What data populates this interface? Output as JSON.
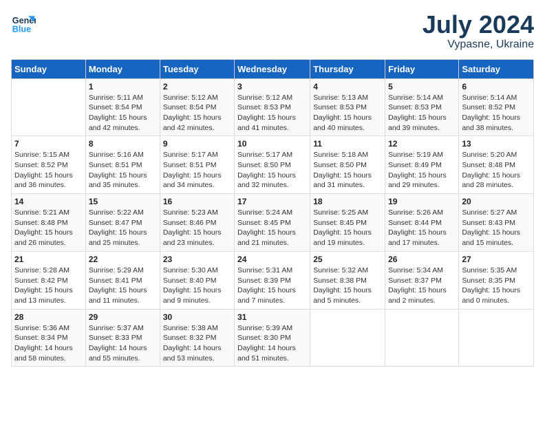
{
  "header": {
    "logo_line1": "General",
    "logo_line2": "Blue",
    "month_year": "July 2024",
    "location": "Vypasne, Ukraine"
  },
  "weekdays": [
    "Sunday",
    "Monday",
    "Tuesday",
    "Wednesday",
    "Thursday",
    "Friday",
    "Saturday"
  ],
  "weeks": [
    [
      {
        "day": "",
        "info": ""
      },
      {
        "day": "1",
        "info": "Sunrise: 5:11 AM\nSunset: 8:54 PM\nDaylight: 15 hours and 42 minutes."
      },
      {
        "day": "2",
        "info": "Sunrise: 5:12 AM\nSunset: 8:54 PM\nDaylight: 15 hours and 42 minutes."
      },
      {
        "day": "3",
        "info": "Sunrise: 5:12 AM\nSunset: 8:53 PM\nDaylight: 15 hours and 41 minutes."
      },
      {
        "day": "4",
        "info": "Sunrise: 5:13 AM\nSunset: 8:53 PM\nDaylight: 15 hours and 40 minutes."
      },
      {
        "day": "5",
        "info": "Sunrise: 5:14 AM\nSunset: 8:53 PM\nDaylight: 15 hours and 39 minutes."
      },
      {
        "day": "6",
        "info": "Sunrise: 5:14 AM\nSunset: 8:52 PM\nDaylight: 15 hours and 38 minutes."
      }
    ],
    [
      {
        "day": "7",
        "info": "Sunrise: 5:15 AM\nSunset: 8:52 PM\nDaylight: 15 hours and 36 minutes."
      },
      {
        "day": "8",
        "info": "Sunrise: 5:16 AM\nSunset: 8:51 PM\nDaylight: 15 hours and 35 minutes."
      },
      {
        "day": "9",
        "info": "Sunrise: 5:17 AM\nSunset: 8:51 PM\nDaylight: 15 hours and 34 minutes."
      },
      {
        "day": "10",
        "info": "Sunrise: 5:17 AM\nSunset: 8:50 PM\nDaylight: 15 hours and 32 minutes."
      },
      {
        "day": "11",
        "info": "Sunrise: 5:18 AM\nSunset: 8:50 PM\nDaylight: 15 hours and 31 minutes."
      },
      {
        "day": "12",
        "info": "Sunrise: 5:19 AM\nSunset: 8:49 PM\nDaylight: 15 hours and 29 minutes."
      },
      {
        "day": "13",
        "info": "Sunrise: 5:20 AM\nSunset: 8:48 PM\nDaylight: 15 hours and 28 minutes."
      }
    ],
    [
      {
        "day": "14",
        "info": "Sunrise: 5:21 AM\nSunset: 8:48 PM\nDaylight: 15 hours and 26 minutes."
      },
      {
        "day": "15",
        "info": "Sunrise: 5:22 AM\nSunset: 8:47 PM\nDaylight: 15 hours and 25 minutes."
      },
      {
        "day": "16",
        "info": "Sunrise: 5:23 AM\nSunset: 8:46 PM\nDaylight: 15 hours and 23 minutes."
      },
      {
        "day": "17",
        "info": "Sunrise: 5:24 AM\nSunset: 8:45 PM\nDaylight: 15 hours and 21 minutes."
      },
      {
        "day": "18",
        "info": "Sunrise: 5:25 AM\nSunset: 8:45 PM\nDaylight: 15 hours and 19 minutes."
      },
      {
        "day": "19",
        "info": "Sunrise: 5:26 AM\nSunset: 8:44 PM\nDaylight: 15 hours and 17 minutes."
      },
      {
        "day": "20",
        "info": "Sunrise: 5:27 AM\nSunset: 8:43 PM\nDaylight: 15 hours and 15 minutes."
      }
    ],
    [
      {
        "day": "21",
        "info": "Sunrise: 5:28 AM\nSunset: 8:42 PM\nDaylight: 15 hours and 13 minutes."
      },
      {
        "day": "22",
        "info": "Sunrise: 5:29 AM\nSunset: 8:41 PM\nDaylight: 15 hours and 11 minutes."
      },
      {
        "day": "23",
        "info": "Sunrise: 5:30 AM\nSunset: 8:40 PM\nDaylight: 15 hours and 9 minutes."
      },
      {
        "day": "24",
        "info": "Sunrise: 5:31 AM\nSunset: 8:39 PM\nDaylight: 15 hours and 7 minutes."
      },
      {
        "day": "25",
        "info": "Sunrise: 5:32 AM\nSunset: 8:38 PM\nDaylight: 15 hours and 5 minutes."
      },
      {
        "day": "26",
        "info": "Sunrise: 5:34 AM\nSunset: 8:37 PM\nDaylight: 15 hours and 2 minutes."
      },
      {
        "day": "27",
        "info": "Sunrise: 5:35 AM\nSunset: 8:35 PM\nDaylight: 15 hours and 0 minutes."
      }
    ],
    [
      {
        "day": "28",
        "info": "Sunrise: 5:36 AM\nSunset: 8:34 PM\nDaylight: 14 hours and 58 minutes."
      },
      {
        "day": "29",
        "info": "Sunrise: 5:37 AM\nSunset: 8:33 PM\nDaylight: 14 hours and 55 minutes."
      },
      {
        "day": "30",
        "info": "Sunrise: 5:38 AM\nSunset: 8:32 PM\nDaylight: 14 hours and 53 minutes."
      },
      {
        "day": "31",
        "info": "Sunrise: 5:39 AM\nSunset: 8:30 PM\nDaylight: 14 hours and 51 minutes."
      },
      {
        "day": "",
        "info": ""
      },
      {
        "day": "",
        "info": ""
      },
      {
        "day": "",
        "info": ""
      }
    ]
  ]
}
